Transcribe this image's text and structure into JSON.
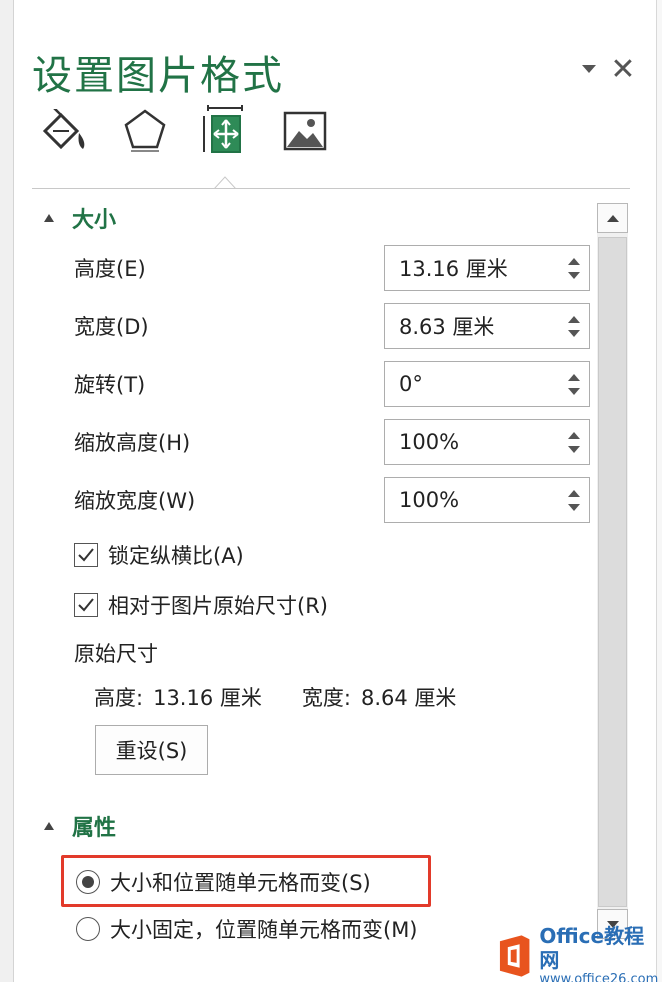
{
  "pane": {
    "title": "设置图片格式",
    "menu_icon": "chevron-down-icon",
    "close_glyph": "✕"
  },
  "tabs": [
    {
      "name": "fill-line",
      "icon": "paint-bucket-icon"
    },
    {
      "name": "effects",
      "icon": "pentagon-icon"
    },
    {
      "name": "size-properties",
      "icon": "size-position-icon",
      "active": true
    },
    {
      "name": "picture",
      "icon": "picture-icon"
    }
  ],
  "size_section": {
    "header": "大小",
    "fields": [
      {
        "label": "高度(E)",
        "value": "13.16 厘米"
      },
      {
        "label": "宽度(D)",
        "value": "8.63 厘米"
      },
      {
        "label": "旋转(T)",
        "value": "0°"
      },
      {
        "label": "缩放高度(H)",
        "value": "100%"
      },
      {
        "label": "缩放宽度(W)",
        "value": "100%"
      }
    ],
    "lock_aspect": {
      "label": "锁定纵横比(A)",
      "checked": true
    },
    "relative_original": {
      "label": "相对于图片原始尺寸(R)",
      "checked": true
    },
    "original_header": "原始尺寸",
    "original_height_label": "高度:",
    "original_height_value": "13.16 厘米",
    "original_width_label": "宽度:",
    "original_width_value": "8.64 厘米",
    "reset_label": "重设(S)"
  },
  "properties_section": {
    "header": "属性",
    "options": [
      {
        "label": "大小和位置随单元格而变(S)",
        "selected": true
      },
      {
        "label": "大小固定，位置随单元格而变(M)",
        "selected": false
      }
    ]
  },
  "watermark": {
    "line1": "Office教程网",
    "line2": "www.office26.com"
  },
  "colors": {
    "accent": "#217346",
    "highlight": "#e23a2a",
    "watermark_blue": "#2a6eb5",
    "watermark_orange": "#e8541e"
  }
}
